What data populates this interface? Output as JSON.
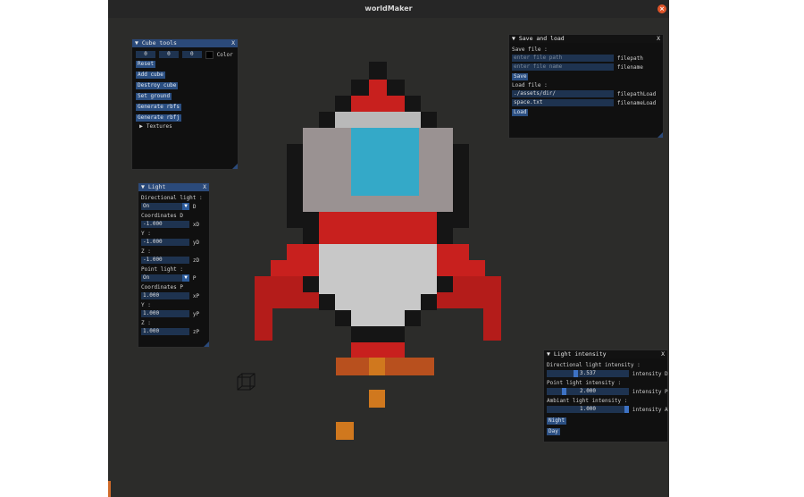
{
  "window": {
    "title": "worldMaker",
    "close_glyph": "×"
  },
  "cube_tools": {
    "title": "Cube tools",
    "close": "X",
    "coords": [
      "0",
      "0",
      "0"
    ],
    "color_label": "Color",
    "buttons": [
      "Reset",
      "Add cube",
      "Destroy cube",
      "Set ground",
      "Generate rbfs",
      "Generate rbfj"
    ],
    "textures_label": "Textures"
  },
  "light": {
    "title": "Light",
    "close": "X",
    "directional_label": "Directional light :",
    "directional_value": "On",
    "directional_suffix": "D",
    "coordinates_d_label": "Coordinates D",
    "d_x": "-1.000",
    "d_x_suffix": "xD",
    "d_y_label": "Y :",
    "d_y": "-1.000",
    "d_y_suffix": "yD",
    "d_z_label": "Z :",
    "d_z": "-1.000",
    "d_z_suffix": "zD",
    "point_label": "Point light :",
    "point_value": "On",
    "point_suffix": "P",
    "coordinates_p_label": "Coordinates P",
    "p_x": "1.000",
    "p_x_suffix": "xP",
    "p_y_label": "Y :",
    "p_y": "1.000",
    "p_y_suffix": "yP",
    "p_z_label": "Z :",
    "p_z": "1.000",
    "p_z_suffix": "zP"
  },
  "save_load": {
    "title": "Save and load",
    "close": "X",
    "save_file_label": "Save file :",
    "filepath_placeholder": "enter file path",
    "filepath_label": "filepath",
    "filename_placeholder": "enter file name",
    "filename_label": "filename",
    "save_button": "Save",
    "load_file_label": "Load file :",
    "load_path_value": "./assets/dir/",
    "load_path_label": "filepathLoad",
    "load_name_value": "space.txt",
    "load_name_label": "filenameLoad",
    "load_button": "Load"
  },
  "intensity": {
    "title": "Light intensity",
    "close": "X",
    "directional_label": "Directional light intensity :",
    "directional_value": "3.537",
    "directional_fraction": 0.35,
    "directional_suffix": "intensity D",
    "point_label": "Point light intensity :",
    "point_value": "2.000",
    "point_fraction": 0.2,
    "point_suffix": "intensity P",
    "ambient_label": "Ambiant light intensity :",
    "ambient_value": "1.000",
    "ambient_fraction": 1.0,
    "ambient_suffix": "intensity A",
    "night_button": "Night",
    "day_button": "Day"
  },
  "colors": {
    "background": "#2c2c2a",
    "panel_header": "#2b4a7a",
    "button": "#2b4f82",
    "rocket_red": "#c8201e",
    "rocket_black": "#151515",
    "rocket_white": "#c8c8c8",
    "rocket_window": "#34a9c8",
    "flame": "#d0781e"
  }
}
